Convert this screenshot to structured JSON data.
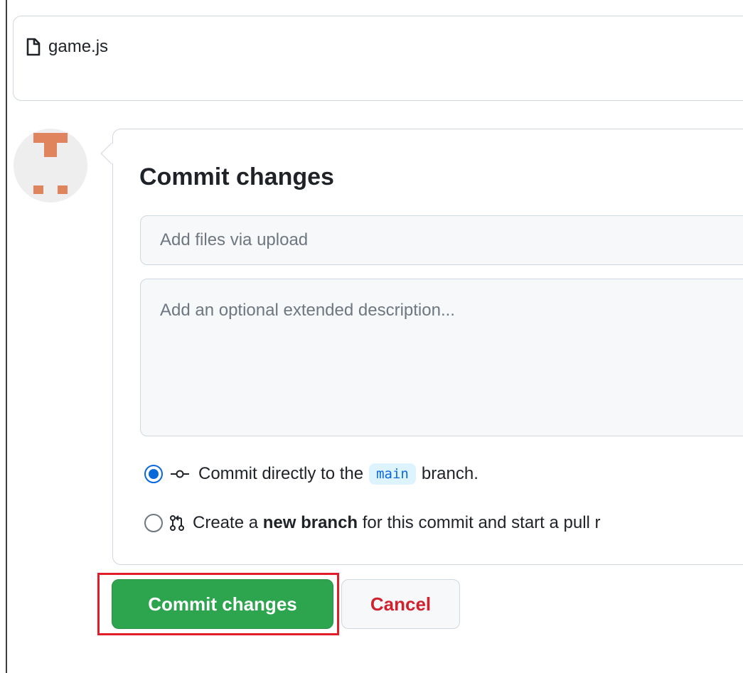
{
  "file": {
    "name": "game.js",
    "icon": "file-icon"
  },
  "commit": {
    "title": "Commit changes",
    "summary_placeholder": "Add files via upload",
    "description_placeholder": "Add an optional extended description...",
    "options": {
      "direct": {
        "prefix": "Commit directly to the",
        "branch": "main",
        "suffix": "branch.",
        "icon": "git-commit-icon",
        "selected": true
      },
      "new_branch": {
        "prefix": "Create a",
        "bold": "new branch",
        "suffix": "for this commit and start a pull r",
        "icon": "git-pull-request-icon",
        "selected": false
      }
    },
    "buttons": {
      "commit_label": "Commit changes",
      "cancel_label": "Cancel"
    }
  },
  "colors": {
    "primary_button": "#2da44e",
    "cancel_text": "#cf222e",
    "radio_accent": "#0969da",
    "highlight": "#e11d2a",
    "avatar_accent": "#e0845e"
  }
}
